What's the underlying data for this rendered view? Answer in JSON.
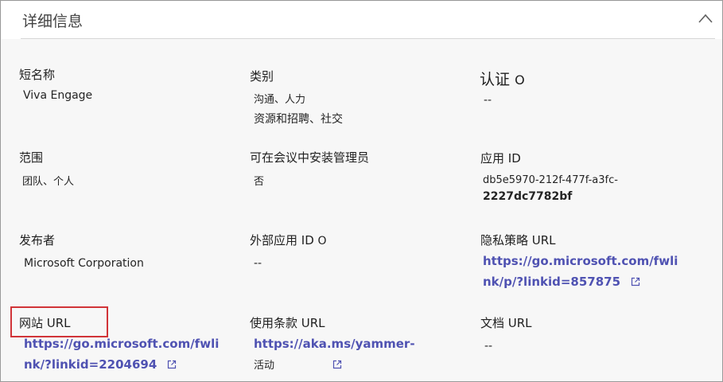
{
  "header": {
    "title": "详细信息"
  },
  "fields": {
    "short_name": {
      "label": "短名称",
      "value": "Viva Engage"
    },
    "category": {
      "label": "类别",
      "line1": "沟通、人力",
      "line2": "资源和招聘、社交"
    },
    "certification": {
      "label": "认证",
      "info": "O",
      "value": "--"
    },
    "scope": {
      "label": "范围",
      "value": "团队、个人"
    },
    "meeting_install": {
      "label": "可在会议中安装管理员",
      "value": "否"
    },
    "app_id": {
      "label": "应用 ID",
      "line1": "db5e5970-212f-477f-a3fc-",
      "line2": "2227dc7782bf"
    },
    "publisher": {
      "label": "发布者",
      "value": "Microsoft Corporation"
    },
    "external_app_id": {
      "label": "外部应用 ID",
      "info": "O",
      "value": "--"
    },
    "privacy_policy": {
      "label": "隐私策略 URL",
      "line1": "https://go.microsoft.com/fwli",
      "line2": "nk/p/?linkid=857875"
    },
    "website": {
      "label": "网站 URL",
      "line1": "https://go.microsoft.com/fwli",
      "line2": "nk/?linkid=2204694"
    },
    "terms": {
      "label": "使用条款 URL",
      "line1": "https://aka.ms/yammer-",
      "line2": "活动"
    },
    "docs": {
      "label": "文档 URL",
      "value": "--"
    }
  },
  "colors": {
    "link": "#4f52b2",
    "highlight": "#d13438"
  },
  "icons": {
    "collapse": "chevron-up-icon",
    "external": "external-link-icon"
  }
}
